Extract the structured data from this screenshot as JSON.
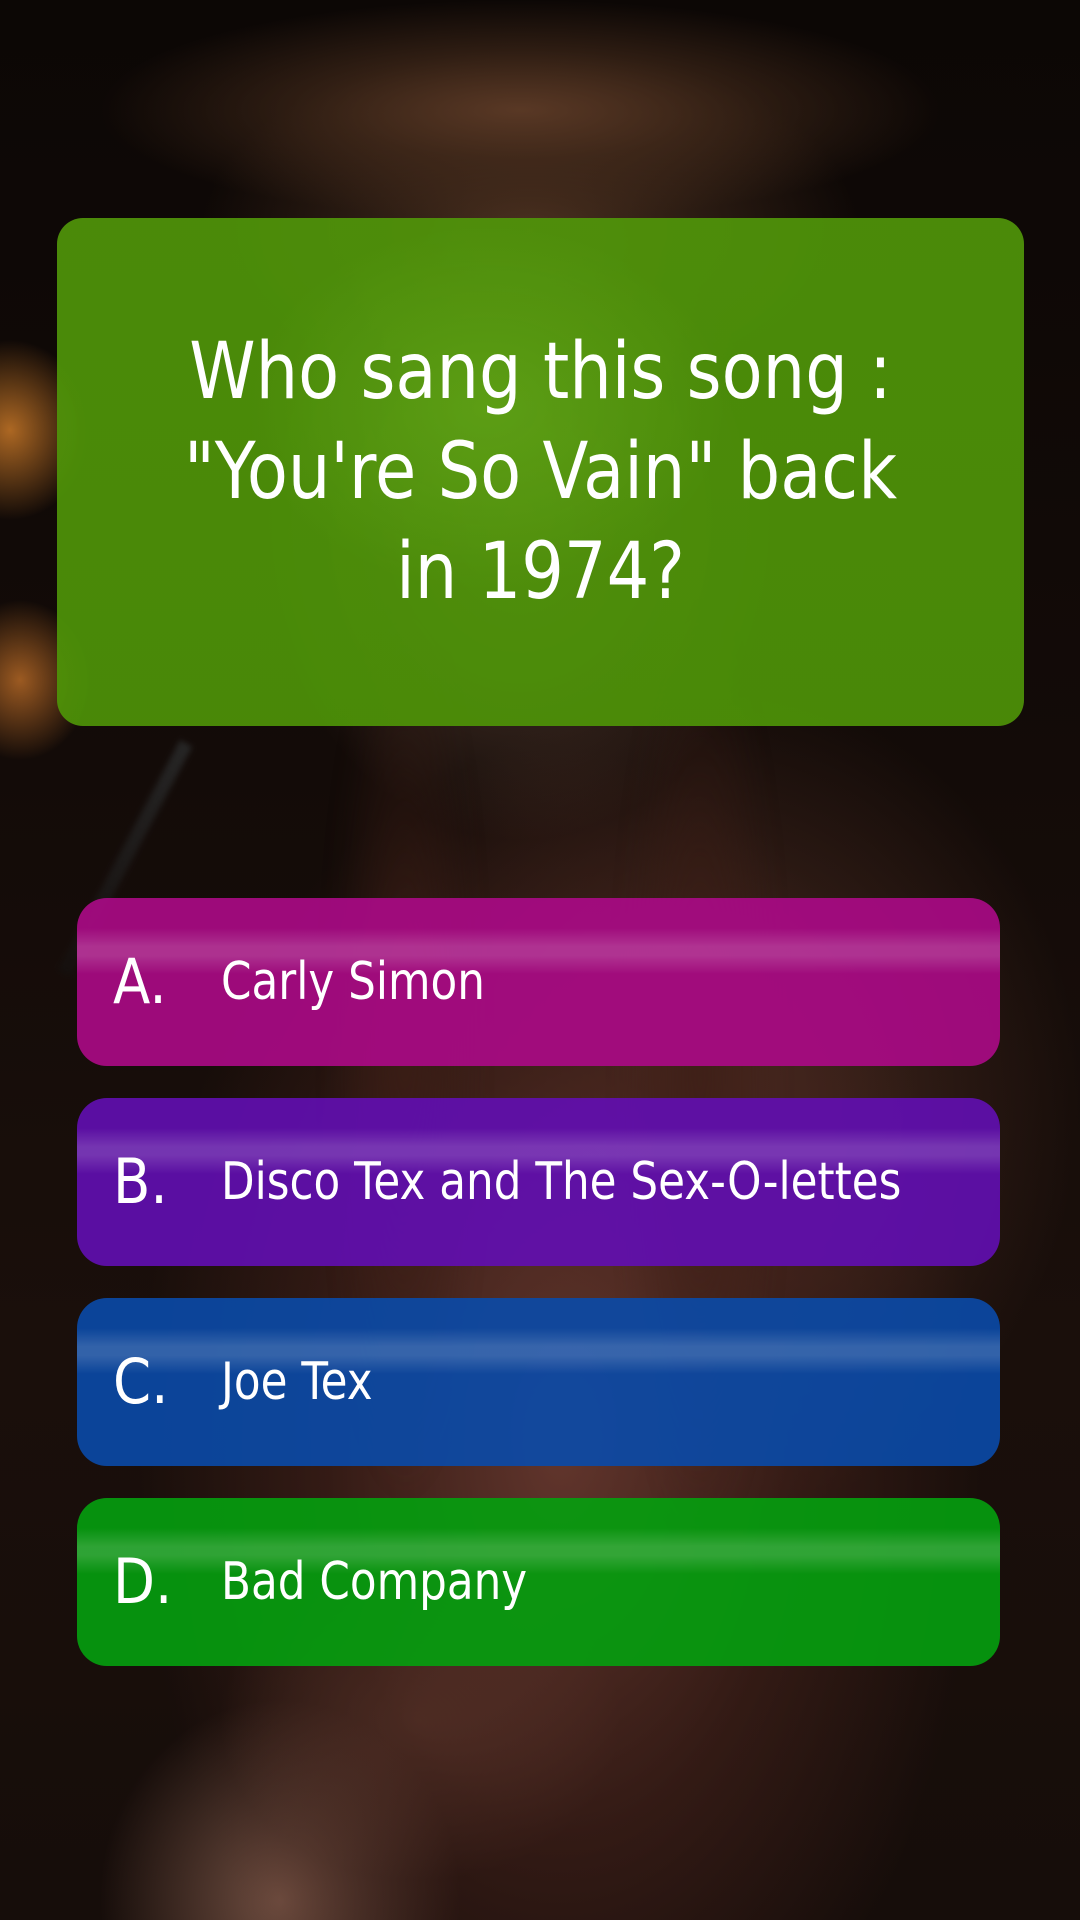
{
  "question": {
    "text": "Who sang this song : \"You're So Vain\" back in 1974?"
  },
  "answers": [
    {
      "letter": "A.",
      "text": "Carly Simon"
    },
    {
      "letter": "B.",
      "text": "Disco Tex and The Sex-O-lettes"
    },
    {
      "letter": "C.",
      "text": "Joe Tex"
    },
    {
      "letter": "D.",
      "text": "Bad Company"
    }
  ],
  "colors": {
    "question_card": "#4f940a",
    "answer_a": "#ac0a87",
    "answer_b": "#620eb2",
    "answer_c": "#0a4aa8",
    "answer_d": "#04a00e",
    "text": "#ffffff"
  }
}
